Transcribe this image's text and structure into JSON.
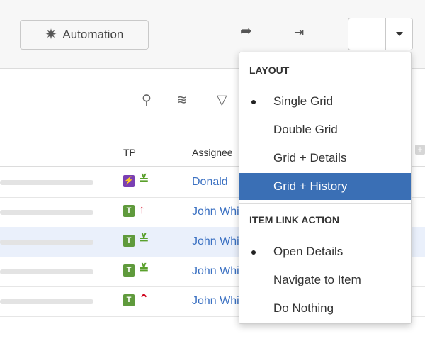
{
  "toolbar": {
    "automation_label": "Automation",
    "icons": {
      "automation": "magic-wand-icon",
      "share": "share-arrow-icon",
      "export": "export-icon",
      "layout": "layout-square-icon",
      "caret": "caret-down-icon"
    }
  },
  "view_icons": [
    "pin-icon",
    "layers-icon",
    "filter-icon"
  ],
  "grid": {
    "columns": {
      "tp": "TP",
      "assignee": "Assignee"
    },
    "rows": [
      {
        "tp_icon": "lightning-icon",
        "tp_color": "#7a3fb3",
        "priority_icon": "chevron-double-down-icon",
        "priority_color": "#5aa02c",
        "assignee": "Donald"
      },
      {
        "tp_icon": "task-icon",
        "tp_color": "#5f9a3c",
        "priority_icon": "arrow-up-icon",
        "priority_color": "#d0021b",
        "assignee": "John White"
      },
      {
        "tp_icon": "task-icon",
        "tp_color": "#5f9a3c",
        "priority_icon": "chevron-double-down-icon",
        "priority_color": "#5aa02c",
        "assignee": "John White",
        "selected": true
      },
      {
        "tp_icon": "task-icon",
        "tp_color": "#5f9a3c",
        "priority_icon": "chevron-double-down-icon",
        "priority_color": "#5aa02c",
        "assignee": "John White"
      },
      {
        "tp_icon": "task-icon",
        "tp_color": "#5f9a3c",
        "priority_icon": "chevron-double-up-icon",
        "priority_color": "#d0021b",
        "assignee": "John White"
      }
    ]
  },
  "menu": {
    "layout_heading": "LAYOUT",
    "layout_items": [
      {
        "label": "Single Grid",
        "checked": true
      },
      {
        "label": "Double Grid",
        "checked": false
      },
      {
        "label": "Grid + Details",
        "checked": false
      },
      {
        "label": "Grid + History",
        "checked": false,
        "highlighted": true
      }
    ],
    "link_heading": "ITEM LINK ACTION",
    "link_items": [
      {
        "label": "Open Details",
        "checked": true
      },
      {
        "label": "Navigate to Item",
        "checked": false
      },
      {
        "label": "Do Nothing",
        "checked": false
      }
    ]
  },
  "colors": {
    "accent": "#3a6fb5",
    "link": "#3a70c2",
    "selected_row": "#eaf0fb"
  }
}
